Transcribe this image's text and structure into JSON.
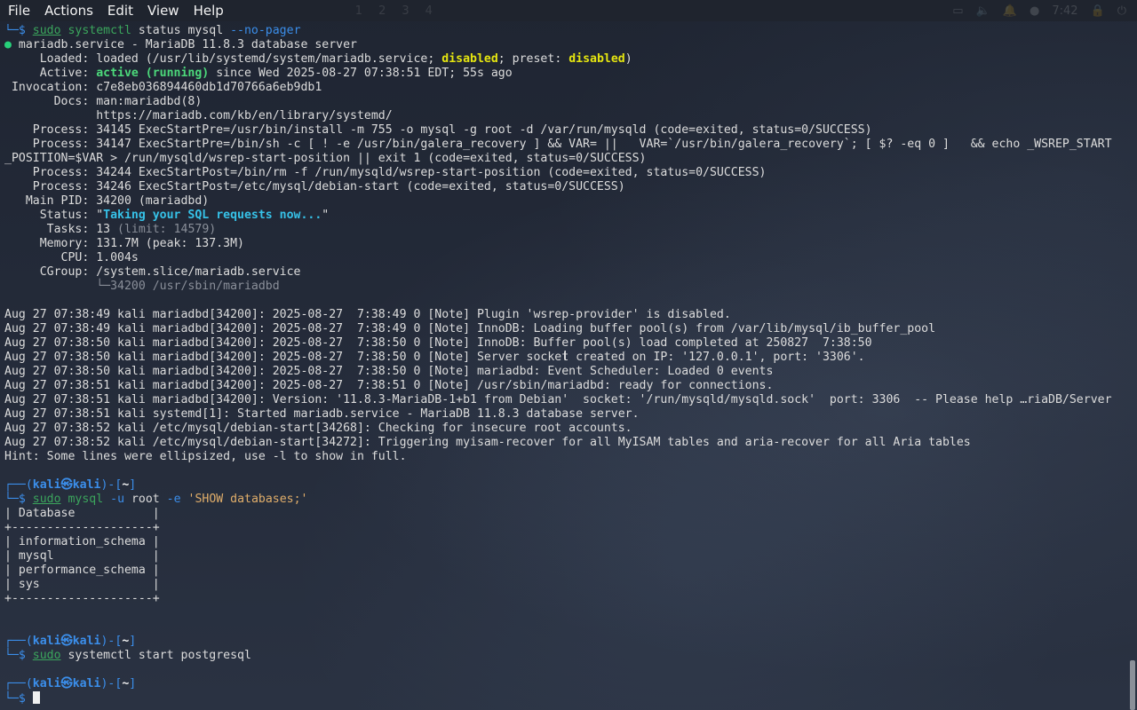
{
  "menubar": {
    "items": [
      "File",
      "Actions",
      "Edit",
      "View",
      "Help"
    ],
    "workspaces": [
      "1",
      "2",
      "3",
      "4"
    ],
    "clock": "7:42"
  },
  "terminal": {
    "lines": [
      "└─$ sudo systemctl status mysql --no-pager",
      "● mariadb.service - MariaDB 11.8.3 database server",
      "     Loaded: loaded (/usr/lib/systemd/system/mariadb.service; disabled; preset: disabled)",
      "     Active: active (running) since Wed 2025-08-27 07:38:51 EDT; 55s ago",
      " Invocation: c7e8eb036894460db1d70766a6eb9db1",
      "       Docs: man:mariadbd(8)",
      "             https://mariadb.com/kb/en/library/systemd/",
      "    Process: 34145 ExecStartPre=/usr/bin/install -m 755 -o mysql -g root -d /var/run/mysqld (code=exited, status=0/SUCCESS)",
      "    Process: 34147 ExecStartPre=/bin/sh -c [ ! -e /usr/bin/galera_recovery ] && VAR= ||   VAR=`/usr/bin/galera_recovery`; [ $? -eq 0 ]   && echo _WSREP_START",
      "_POSITION=$VAR > /run/mysqld/wsrep-start-position || exit 1 (code=exited, status=0/SUCCESS)",
      "    Process: 34244 ExecStartPost=/bin/rm -f /run/mysqld/wsrep-start-position (code=exited, status=0/SUCCESS)",
      "    Process: 34246 ExecStartPost=/etc/mysql/debian-start (code=exited, status=0/SUCCESS)",
      "   Main PID: 34200 (mariadbd)",
      "     Status: \"Taking your SQL requests now...\"",
      "      Tasks: 13 (limit: 14579)",
      "     Memory: 131.7M (peak: 137.3M)",
      "        CPU: 1.004s",
      "     CGroup: /system.slice/mariadb.service",
      "             └─34200 /usr/sbin/mariadbd",
      "",
      "Aug 27 07:38:49 kali mariadbd[34200]: 2025-08-27  7:38:49 0 [Note] Plugin 'wsrep-provider' is disabled.",
      "Aug 27 07:38:49 kali mariadbd[34200]: 2025-08-27  7:38:49 0 [Note] InnoDB: Loading buffer pool(s) from /var/lib/mysql/ib_buffer_pool",
      "Aug 27 07:38:50 kali mariadbd[34200]: 2025-08-27  7:38:50 0 [Note] InnoDB: Buffer pool(s) load completed at 250827  7:38:50",
      "Aug 27 07:38:50 kali mariadbd[34200]: 2025-08-27  7:38:50 0 [Note] Server socket created on IP: '127.0.0.1', port: '3306'.",
      "Aug 27 07:38:50 kali mariadbd[34200]: 2025-08-27  7:38:50 0 [Note] mariadbd: Event Scheduler: Loaded 0 events",
      "Aug 27 07:38:51 kali mariadbd[34200]: 2025-08-27  7:38:51 0 [Note] /usr/sbin/mariadbd: ready for connections.",
      "Aug 27 07:38:51 kali mariadbd[34200]: Version: '11.8.3-MariaDB-1+b1 from Debian'  socket: '/run/mysqld/mysqld.sock'  port: 3306  -- Please help …riaDB/Server",
      "Aug 27 07:38:51 kali systemd[1]: Started mariadb.service - MariaDB 11.8.3 database server.",
      "Aug 27 07:38:52 kali /etc/mysql/debian-start[34268]: Checking for insecure root accounts.",
      "Aug 27 07:38:52 kali /etc/mysql/debian-start[34272]: Triggering myisam-recover for all MyISAM tables and aria-recover for all Aria tables",
      "Hint: Some lines were ellipsized, use -l to show in full.",
      "",
      "┌──(kali㉿kali)-[~]",
      "└─$ sudo mysql -u root -e 'SHOW databases;'",
      "+--------------------+",
      "| Database           |",
      "+--------------------+",
      "| information_schema |",
      "| mysql              |",
      "| performance_schema |",
      "| sys                |",
      "+--------------------+",
      "",
      "┌──(kali㉿kali)-[~]",
      "└─$ sudo systemctl start postgresql",
      "",
      "┌──(kali㉿kali)-[~]",
      "└─$ "
    ]
  },
  "colors": {
    "prompt_blue": "#3b8eea",
    "active_green": "#4cd97b",
    "disabled_yellow": "#e5e510",
    "status_cyan": "#36c2e8",
    "command_orange": "#e0ae6a"
  }
}
